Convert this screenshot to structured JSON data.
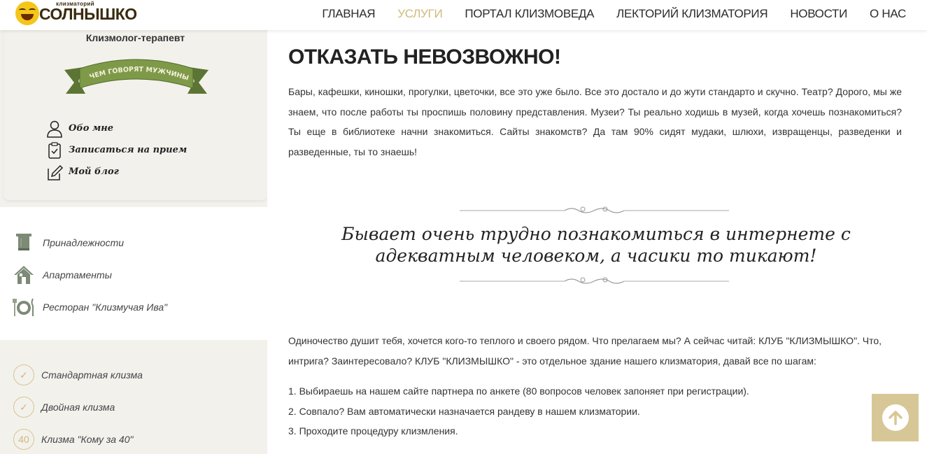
{
  "logo": {
    "small": "клизматорий",
    "big": "СОЛНЫШКО"
  },
  "nav": [
    {
      "label": "ГЛАВНАЯ",
      "active": false
    },
    {
      "label": "УСЛУГИ",
      "active": true
    },
    {
      "label": "ПОРТАЛ КЛИЗМОВЕДА",
      "active": false
    },
    {
      "label": "ЛЕКТОРИЙ КЛИЗМАТОРИЯ",
      "active": false
    },
    {
      "label": "НОВОСТИ",
      "active": false
    },
    {
      "label": "О НАС",
      "active": false
    }
  ],
  "sidebar": {
    "title": "Клизмолог-терапевт",
    "ribbon": "О ЧЕМ ГОВОРЯТ МУЖЧИНЫ?",
    "profile_menu": [
      {
        "label": "Обо мне",
        "icon": "user-icon"
      },
      {
        "label": "Записаться на прием",
        "icon": "clipboard-icon"
      },
      {
        "label": "Мой блог",
        "icon": "edit-icon"
      }
    ],
    "facility_menu": [
      {
        "label": "Принадлежности",
        "icon": "towel-icon"
      },
      {
        "label": "Апартаменты",
        "icon": "house-icon"
      },
      {
        "label": "Ресторан \"Клизмучая Ива\"",
        "icon": "dining-icon"
      }
    ],
    "service_menu": [
      {
        "label": "Стандартная клизма",
        "icon": "check-circle-icon",
        "glyph": "✓"
      },
      {
        "label": "Двойная клизма",
        "icon": "check-circle-icon",
        "glyph": "✓"
      },
      {
        "label": "Клизма \"Кому за 40\"",
        "icon": "forty-circle-icon",
        "glyph": "40"
      }
    ]
  },
  "main": {
    "heading": "ОТКАЗАТЬ НЕВОЗВОЖНО!",
    "paragraph1": "Бары, кафешки, киношки, прогулки, цветочки, все это уже было. Все это достало и до жути стандарто и скучно. Театр? Дорого, мы же знаем, что после работы ты проспишь половину представления. Музеи? Ты реально ходишь в музей, когда хочешь познакомиться? Ты еще в библиотеке начни знакомиться. Сайты знакомств? Да там 90% сидят мудаки, шлюхи, извращенцы, разведенки и разведенные, ты то знаешь!",
    "quote": "Бывает очень трудно познакомиться в интернете с адекватным человеком, а часики то тикают!",
    "paragraph2": "Одиночество душит тебя, хочется кого-то теплого и своего рядом. Что прелагаем мы? А сейчас читай: КЛУБ \"КЛИЗМЫШКО\". Что, интрига? Заинтересовало? КЛУБ \"КЛИЗМЫШКО\" - это отдельное здание нашего клизматория, давай все по шагам:",
    "steps": [
      "1. Выбираешь на нашем сайте партнера по анкете (80 вопросов человек запоняет при регистрации).",
      "2. Совпало? Вам автоматически назначается рандеву в нашем клизматории.",
      "3. Проходите процедуру клизмления."
    ]
  },
  "colors": {
    "accent": "#d1b97a",
    "ribbon": "#6f8a3f",
    "scroll_button": "#d8c796"
  }
}
